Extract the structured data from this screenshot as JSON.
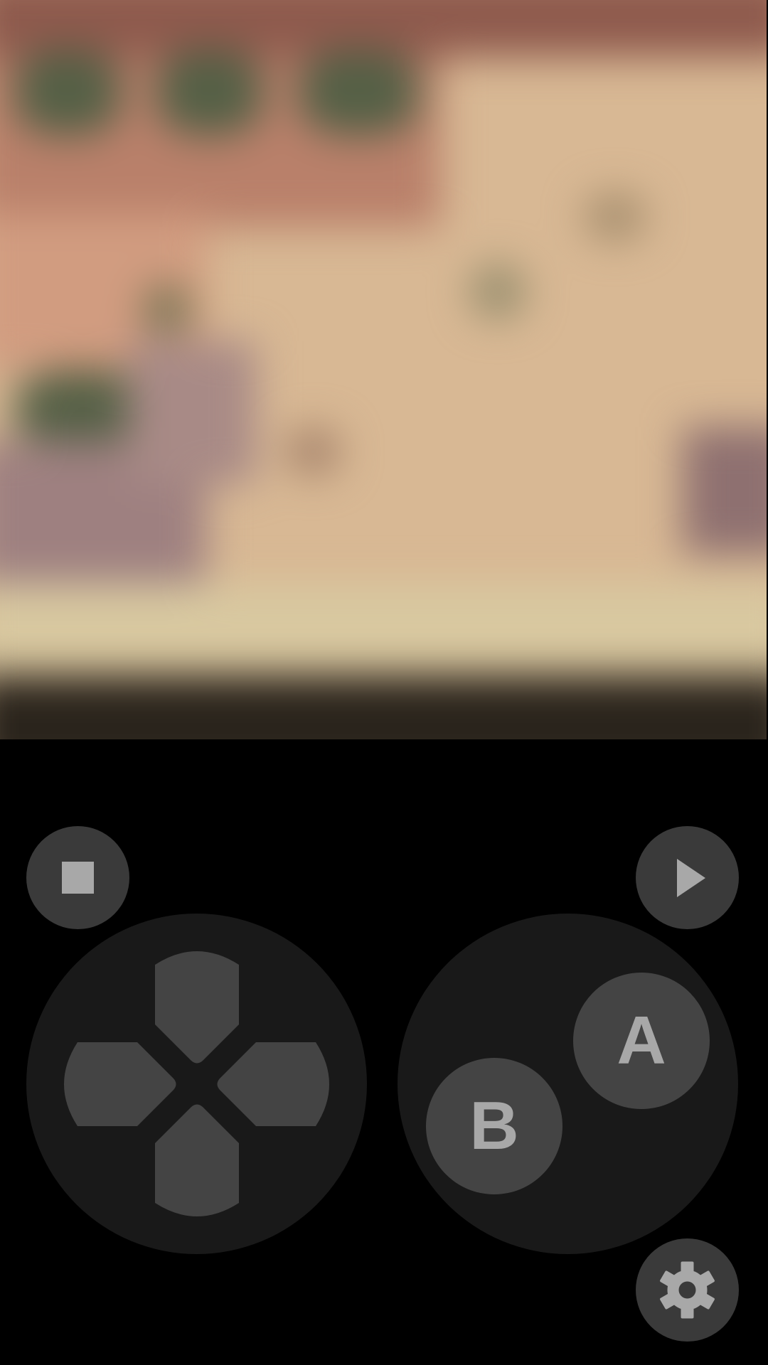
{
  "game_view": {
    "content": "blurred-game-frame"
  },
  "controls": {
    "stop_icon": "stop-icon",
    "play_icon": "play-icon",
    "settings_icon": "gear-icon",
    "a_label": "A",
    "b_label": "B",
    "dpad_directions": [
      "up",
      "down",
      "left",
      "right"
    ]
  },
  "colors": {
    "background": "#000000",
    "pad_fill": "#191919",
    "button_fill": "#444444",
    "small_button_fill": "#3a3a3a",
    "icon_fill": "#a8a8a8"
  }
}
